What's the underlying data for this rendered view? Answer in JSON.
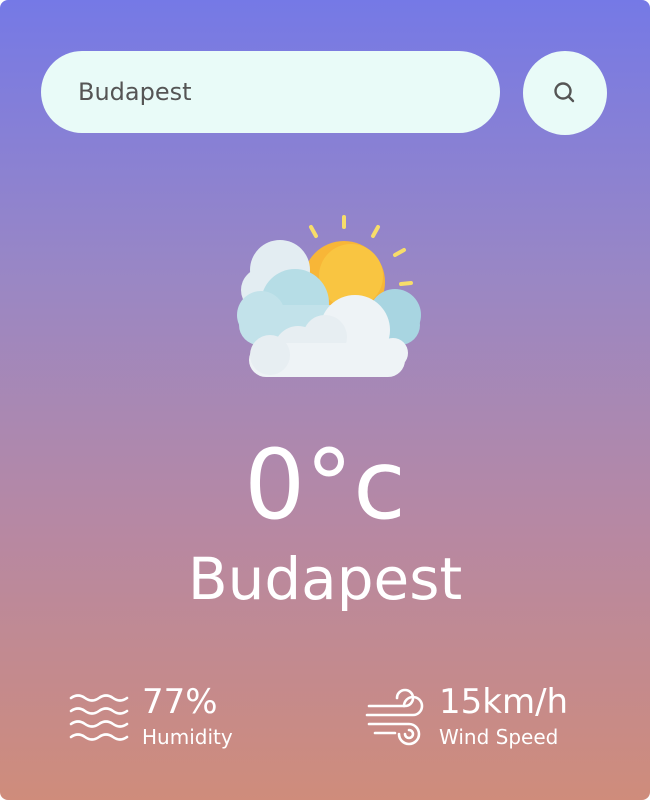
{
  "search": {
    "value": "Budapest"
  },
  "weather": {
    "temperature": "0°c",
    "city": "Budapest",
    "condition_icon": "partly-cloudy-icon"
  },
  "stats": {
    "humidity": {
      "value": "77%",
      "label": "Humidity",
      "icon": "humidity-waves-icon"
    },
    "wind": {
      "value": "15km/h",
      "label": "Wind Speed",
      "icon": "wind-icon"
    }
  },
  "colors": {
    "gradient_top": "#7579e6",
    "gradient_bottom": "#cf8c7b",
    "search_background": "#e9fbf8",
    "text": "#ffffff"
  }
}
